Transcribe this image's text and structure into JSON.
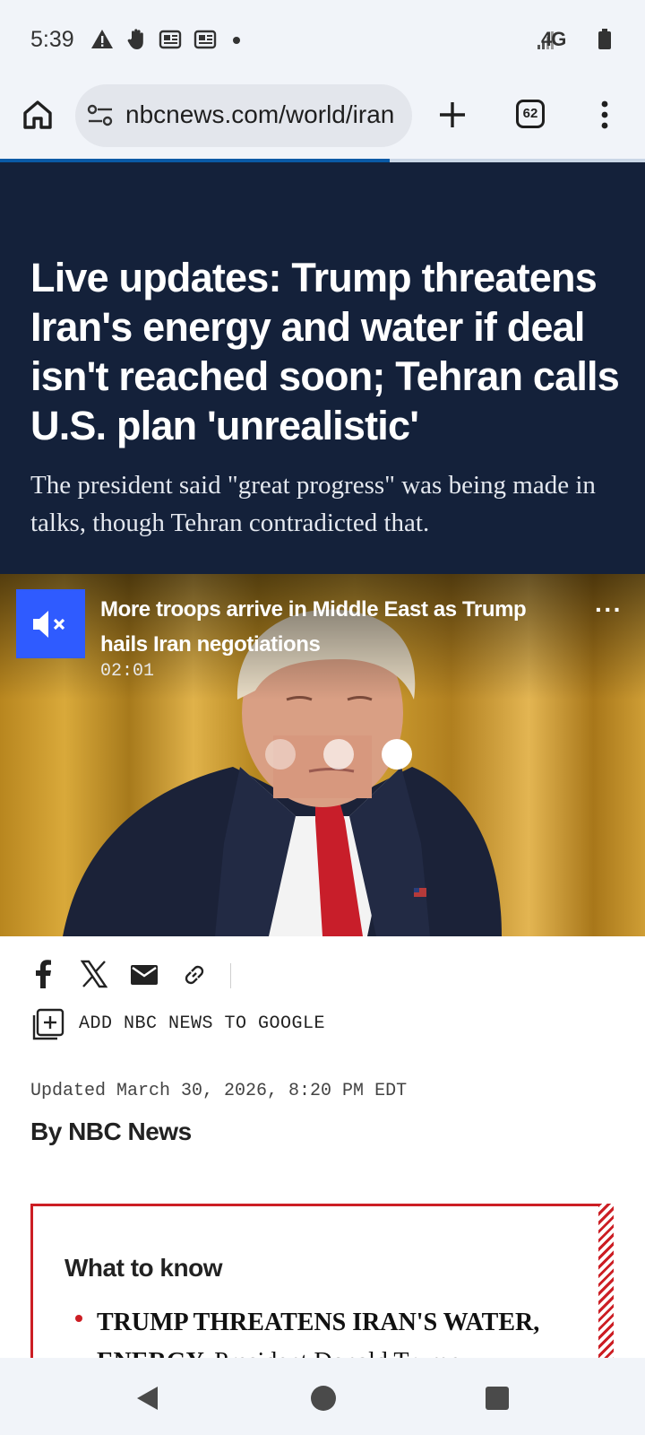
{
  "status_bar": {
    "time": "5:39",
    "left_icons": [
      "warning-icon",
      "hand-icon",
      "news-icon",
      "news-icon",
      "dot-icon"
    ],
    "network": "4G",
    "right_icons": [
      "signal-icon",
      "battery-icon"
    ]
  },
  "browser": {
    "url": "nbcnews.com/world/iran",
    "tab_count": "62",
    "load_progress": 0.6,
    "icons": [
      "home-icon",
      "site-settings-icon",
      "new-tab-icon",
      "tabs-icon",
      "menu-icon"
    ]
  },
  "article": {
    "headline": "Live updates: Trump threatens Iran's energy and water if deal isn't reached soon; Tehran calls U.S. plan 'unrealistic'",
    "dek": "The president said \"great progress\" was being made in talks, though Tehran contradicted that.",
    "video": {
      "title": "More troops arrive in Middle East as Trump hails Iran negotiations",
      "duration": "02:01",
      "more": "···"
    },
    "share": {
      "icons": [
        "facebook-icon",
        "x-icon",
        "email-icon",
        "link-icon"
      ],
      "google_label": "ADD NBC NEWS TO GOOGLE"
    },
    "updated": "Updated March 30, 2026, 8:20 PM EDT",
    "byline": "By NBC News",
    "what_to_know": {
      "title": "What to know",
      "first_item_bold": "TRUMP THREATENS IRAN'S WATER, ENERGY.",
      "first_item_text": " President Donald Trump"
    }
  },
  "colors": {
    "hero_bg": "#14213a",
    "accent_red": "#cc1e24",
    "mute_blue": "#2f5bff",
    "progress_blue": "#0a5aa6"
  }
}
